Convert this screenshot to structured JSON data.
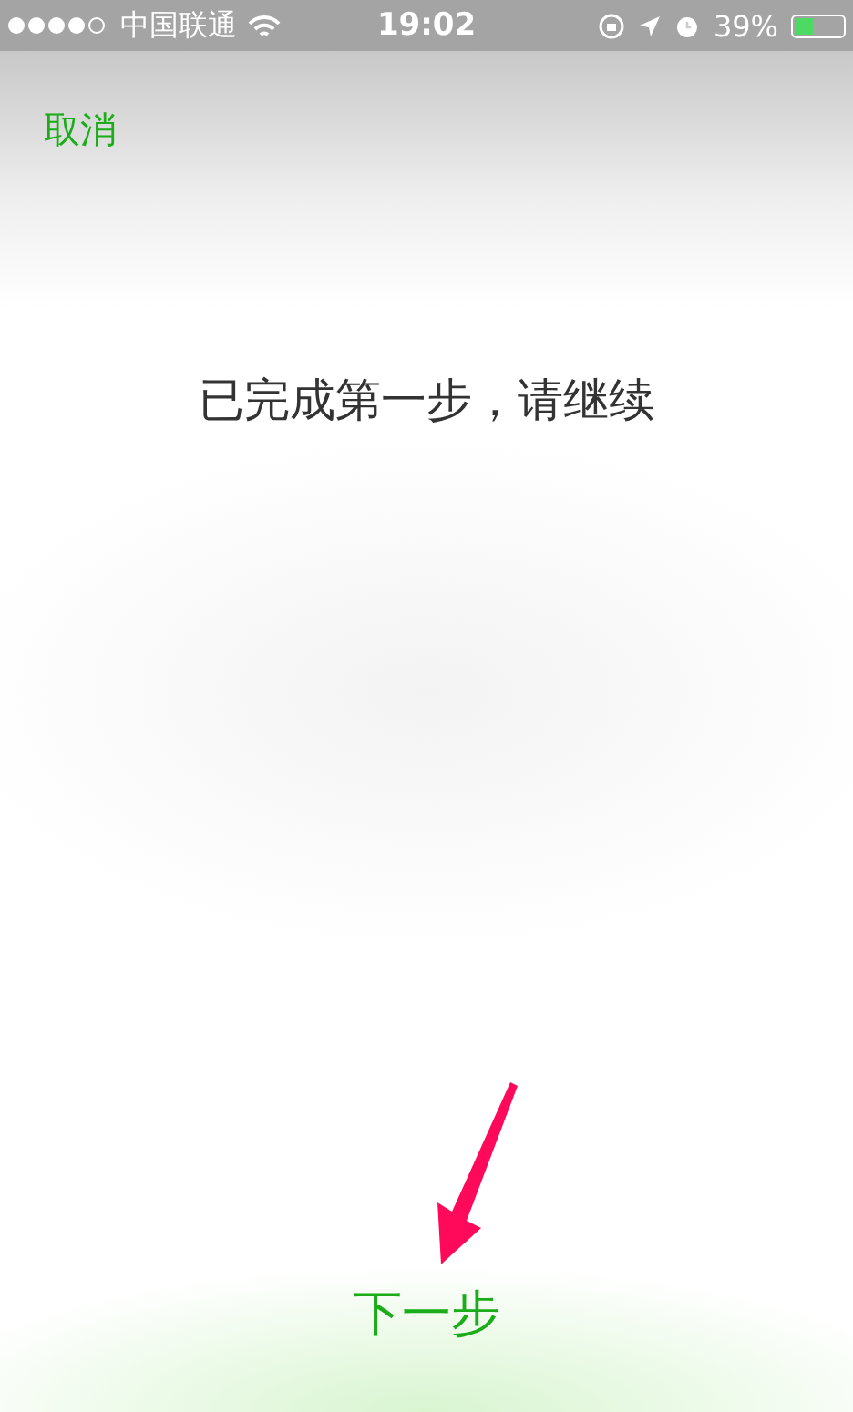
{
  "status_bar": {
    "carrier": "中国联通",
    "time": "19:02",
    "battery_text": "39%",
    "battery": {
      "level": 0.39
    }
  },
  "cancel_button": {
    "label": "取消"
  },
  "message": "已完成第一步，请继续",
  "next_button": {
    "label": "下一步"
  }
}
